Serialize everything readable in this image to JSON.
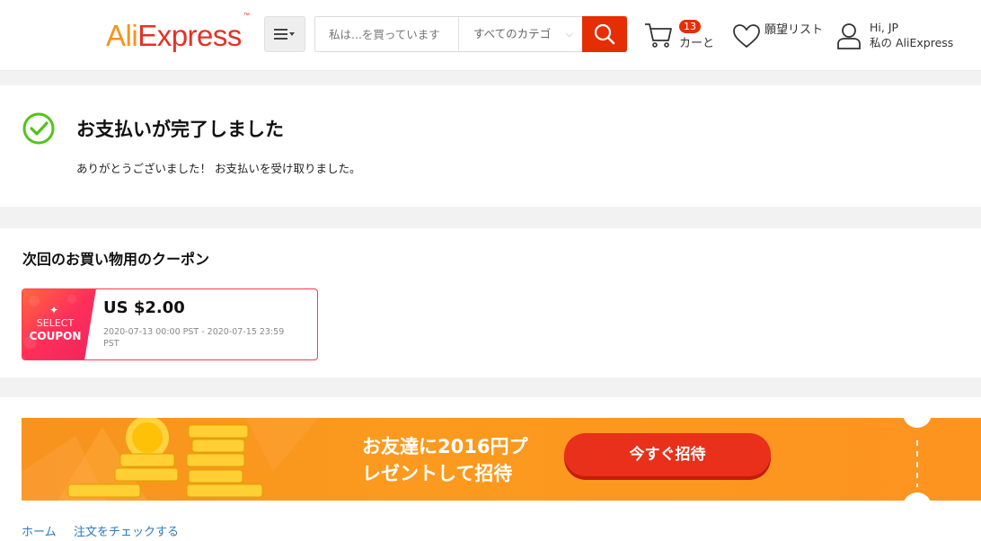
{
  "header": {
    "logo_text_part1": "Ali",
    "logo_text_part2": "Express",
    "logo_tm": "™",
    "search_placeholder": "私は...を買っています",
    "category_label": "すべてのカテゴ",
    "cart_count": "13",
    "cart_label": "カーと",
    "wishlist_label": "願望リスト",
    "greeting": "Hi, JP",
    "account_label": "私の AliExpress"
  },
  "payment": {
    "title": "お支払いが完了しました",
    "message": "ありがとうございました！ お支払いを受け取りました。"
  },
  "coupons": {
    "heading": "次回のお買い物用のクーポン",
    "items": [
      {
        "badge_top": "SELECT",
        "badge_bottom": "COUPON",
        "amount": "US $2.00",
        "validity": "2020-07-13 00:00 PST - 2020-07-15 23:59 PST"
      }
    ]
  },
  "banner": {
    "text_line1": "お友達に2016円プ",
    "text_line2": "レゼントして招待",
    "button_label": "今すぐ招待"
  },
  "footer": {
    "links": [
      "ホーム",
      "注文をチェックする"
    ]
  },
  "colors": {
    "brand_red": "#e62e04",
    "brand_orange": "#f7931e",
    "success_green": "#52c41a",
    "link_blue": "#2b79c2"
  }
}
